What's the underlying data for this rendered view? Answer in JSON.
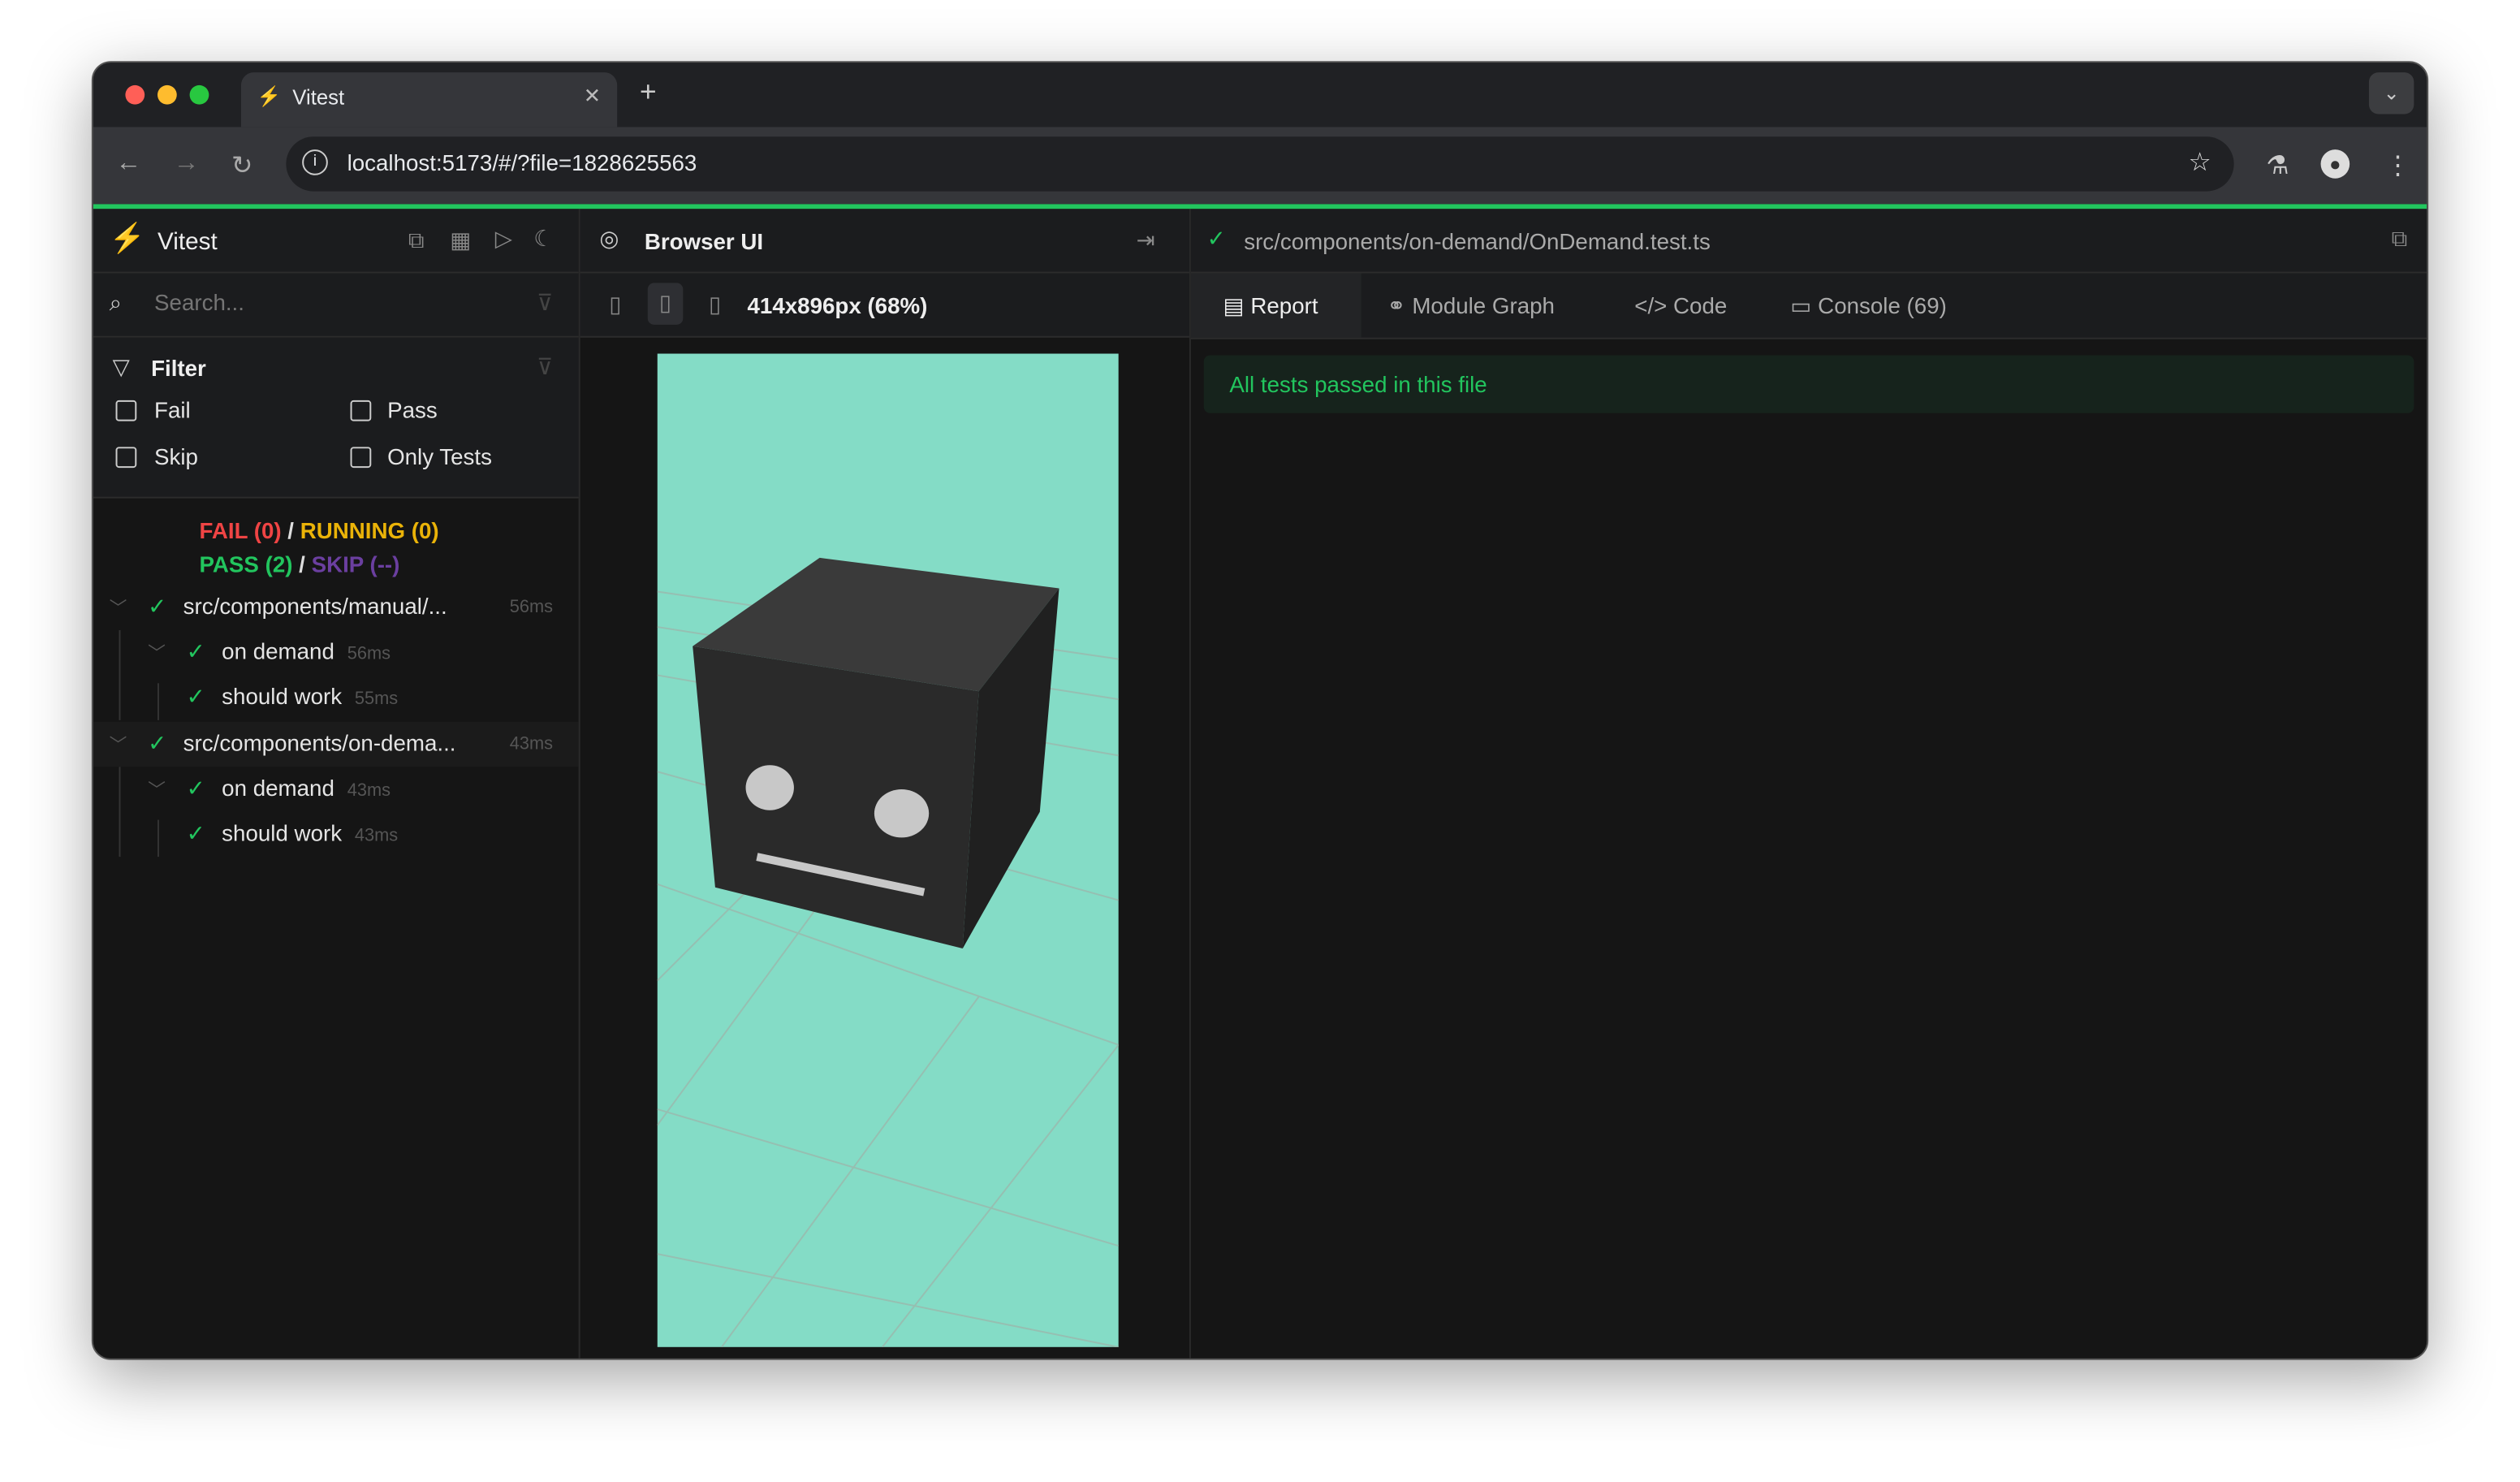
{
  "browser": {
    "tab_title": "Vitest",
    "url": "localhost:5173/#/?file=1828625563"
  },
  "sidebar": {
    "app_name": "Vitest",
    "search_placeholder": "Search...",
    "filter_title": "Filter",
    "filters": [
      {
        "label": "Fail",
        "checked": false
      },
      {
        "label": "Pass",
        "checked": false
      },
      {
        "label": "Skip",
        "checked": false
      },
      {
        "label": "Only Tests",
        "checked": false
      }
    ],
    "summary": {
      "fail": "FAIL (0)",
      "running": "RUNNING (0)",
      "pass": "PASS (2)",
      "skip": "SKIP (--)",
      "sep": "/"
    },
    "tree": [
      {
        "label": "src/components/manual/...",
        "time": "56ms",
        "level": 0
      },
      {
        "label": "on demand",
        "time": "56ms",
        "level": 1
      },
      {
        "label": "should work",
        "time": "55ms",
        "level": 2
      },
      {
        "label": "src/components/on-dema...",
        "time": "43ms",
        "level": 0
      },
      {
        "label": "on demand",
        "time": "43ms",
        "level": 1
      },
      {
        "label": "should work",
        "time": "43ms",
        "level": 2
      }
    ]
  },
  "browser_ui": {
    "title": "Browser UI",
    "viewport": "414x896px (68%)",
    "scene_bg": "#84dcc6"
  },
  "detail": {
    "file_path": "src/components/on-demand/OnDemand.test.ts",
    "tabs": [
      "Report",
      "Module Graph",
      "Code",
      "Console (69)"
    ],
    "active_tab": "Report",
    "status": "All tests passed in this file"
  },
  "colors": {
    "pass": "#22c55e",
    "fail": "#ef4444",
    "running": "#eab308",
    "skip": "#6b3fa0"
  }
}
